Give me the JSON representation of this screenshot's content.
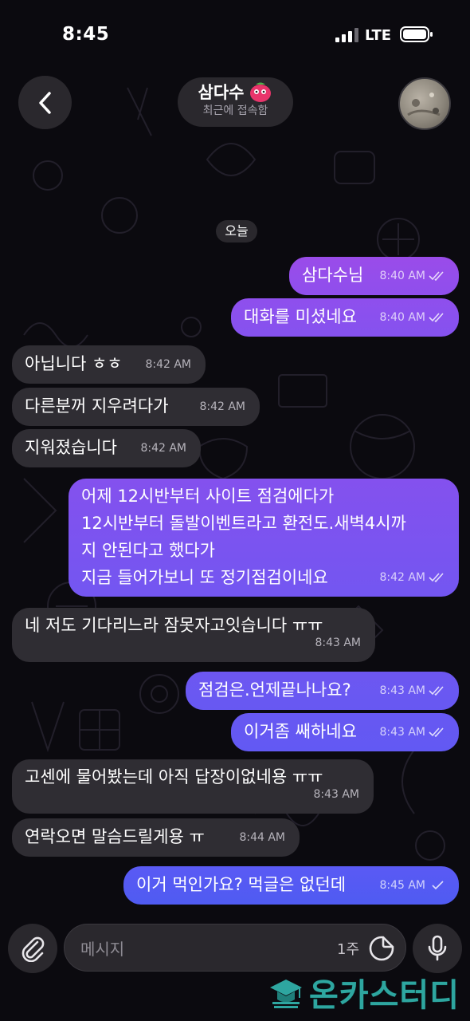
{
  "status_bar": {
    "time": "8:45",
    "network": "LTE"
  },
  "header": {
    "title": "삼다수",
    "status": "최근에 접속함"
  },
  "date_chip": "오늘",
  "messages": [
    {
      "direction": "out",
      "text": "삼다수님",
      "time": "8:40 AM",
      "read": true
    },
    {
      "direction": "out",
      "text": "대화를 미셨네요",
      "time": "8:40 AM",
      "read": true
    },
    {
      "direction": "in",
      "text": "아닙니다 ㅎㅎ",
      "time": "8:42 AM"
    },
    {
      "direction": "in",
      "text": "다른분꺼 지우려다가",
      "time": "8:42 AM"
    },
    {
      "direction": "in",
      "text": "지워졌습니다",
      "time": "8:42 AM"
    },
    {
      "direction": "out",
      "text": "어제 12시반부터 사이트 점검에다가\n12시반부터 돌발이벤트라고 환전도.새벽4시까\n지 안된다고 했다가\n지금 들어가보니 또 정기점검이네요",
      "time": "8:42 AM",
      "read": true
    },
    {
      "direction": "in",
      "text": "네 저도 기다리느라 잠못자고잇습니다 ㅠㅠ",
      "time": "8:43 AM"
    },
    {
      "direction": "out",
      "text": "점검은.언제끝나나요?",
      "time": "8:43 AM",
      "read": true
    },
    {
      "direction": "out",
      "text": "이거좀 쌔하네요",
      "time": "8:43 AM",
      "read": true
    },
    {
      "direction": "in",
      "text": "고센에 물어봤는데 아직 답장이없네용 ㅠㅠ",
      "time": "8:43 AM"
    },
    {
      "direction": "in",
      "text": "연락오면 말슴드릴게용 ㅠ",
      "time": "8:44 AM"
    },
    {
      "direction": "out",
      "text": "이거 먹인가요? 먹글은 없던데",
      "time": "8:45 AM",
      "read": false
    }
  ],
  "composer": {
    "placeholder": "메시지",
    "timer_label": "1주"
  },
  "watermark": {
    "text": "온카스터디"
  },
  "colors": {
    "background": "#0b0a0f",
    "incoming_bubble": "#2f2d33",
    "outgoing_gradient_top": "#9a4bea",
    "outgoing_gradient_bottom": "#4f5bf2",
    "watermark": "#2ea6a0"
  },
  "icons": {
    "back": "chevron-left-icon",
    "title_badge": "strawberry-icon",
    "attach": "paperclip-icon",
    "sticker": "sticker-icon",
    "mic": "microphone-icon",
    "watermark": "graduation-cap-icon"
  }
}
